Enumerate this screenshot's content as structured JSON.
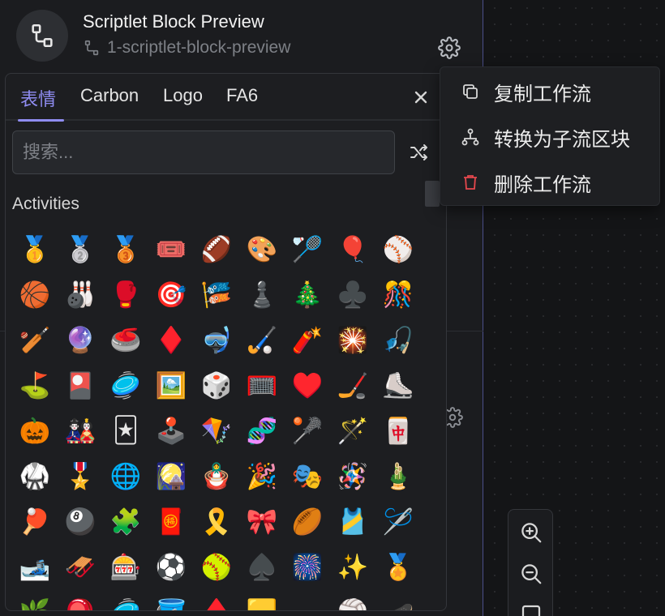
{
  "header": {
    "title": "Scriptlet Block Preview",
    "subtitle": "1-scriptlet-block-preview",
    "avatar_icon": "flow-icon",
    "settings_icon": "gear-icon"
  },
  "picker": {
    "tabs": [
      {
        "label": "表情",
        "active": true
      },
      {
        "label": "Carbon",
        "active": false
      },
      {
        "label": "Logo",
        "active": false
      },
      {
        "label": "FA6",
        "active": false
      }
    ],
    "search_placeholder": "搜索...",
    "section_title": "Activities",
    "accent": "#8f8cf0",
    "emojis": [
      "🥇",
      "🥈",
      "🥉",
      "🎟️",
      "🏈",
      "🎨",
      "🏸",
      "🎈",
      "⚾",
      "🏀",
      "🎳",
      "🥊",
      "🎯",
      "🎏",
      "♟️",
      "🎄",
      "♣️",
      "🎊",
      "🏏",
      "🔮",
      "🥌",
      "♦️",
      "🤿",
      "🏑",
      "🧨",
      "🎇",
      "🎣",
      "⛳",
      "🎴",
      "🥏",
      "🖼️",
      "🎲",
      "🥅",
      "♥️",
      "🏒",
      "⛸️",
      "🎃",
      "🎎",
      "🃏",
      "🕹️",
      "🪁",
      "🧬",
      "🥍",
      "🪄",
      "🀄",
      "🥋",
      "🎖️",
      "🌐",
      "🎑",
      "🪆",
      "🎉",
      "🎭",
      "🪅",
      "🎍",
      "🏓",
      "🎱",
      "🧩",
      "🧧",
      "🎗️",
      "🎀",
      "🏉",
      "🎽",
      "🪡",
      "🎿",
      "🛷",
      "🎰",
      "⚽",
      "🥎",
      "♠️",
      "🎆",
      "✨",
      "🏅",
      "🌿",
      "🪀",
      "🥏",
      "🪣",
      "♦️",
      "🟨",
      "",
      "🏐",
      "🛹"
    ]
  },
  "menu": {
    "items": [
      {
        "label": "复制工作流",
        "icon": "copy-icon"
      },
      {
        "label": "转换为子流区块",
        "icon": "subflow-icon"
      },
      {
        "label": "删除工作流",
        "icon": "trash-icon",
        "color": "#e5484d"
      }
    ]
  },
  "zoom": {
    "zoom_in_icon": "zoom-in-icon",
    "zoom_out_icon": "zoom-out-icon"
  }
}
